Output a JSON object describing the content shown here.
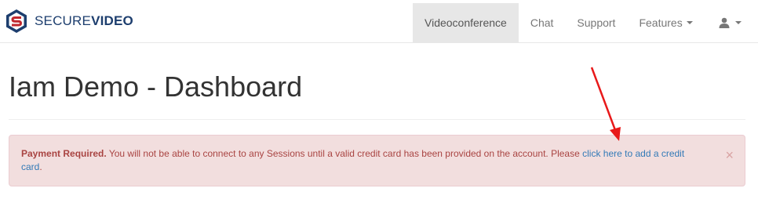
{
  "brand": {
    "name_part1": "SECURE",
    "name_part2": "VIDEO"
  },
  "nav": {
    "items": [
      {
        "label": "Videoconference",
        "active": true
      },
      {
        "label": "Chat"
      },
      {
        "label": "Support"
      },
      {
        "label": "Features"
      }
    ],
    "user_icon": "user-icon"
  },
  "page": {
    "title": "Iam Demo - Dashboard"
  },
  "alert": {
    "strong": "Payment Required.",
    "text": " You will not be able to connect to any Sessions until a valid credit card has been provided on the account. Please ",
    "link_text": "click here to add a credit card",
    "suffix": ".",
    "close": "×"
  },
  "colors": {
    "brand": "#1d3e6e",
    "alert_bg": "#f2dede",
    "alert_text": "#a94442",
    "link": "#337ab7",
    "annotation_arrow": "#e8191a"
  }
}
